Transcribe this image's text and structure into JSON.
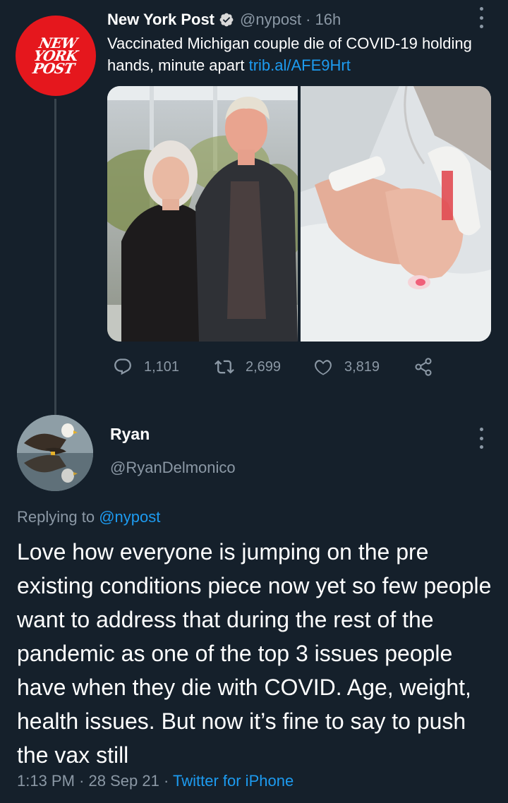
{
  "parent_tweet": {
    "avatar_logo": [
      "NEW",
      "YORK",
      "POST"
    ],
    "display_name": "New York Post",
    "handle": "@nypost",
    "separator": "·",
    "time": "16h",
    "text": "Vaccinated Michigan couple die of COVID-19 holding hands, minute apart",
    "link": "trib.al/AFE9Hrt",
    "stats": {
      "replies": "1,101",
      "retweets": "2,699",
      "likes": "3,819"
    },
    "icons": [
      "verified-badge-icon",
      "more-options-icon",
      "reply-icon",
      "retweet-icon",
      "like-icon",
      "share-icon"
    ]
  },
  "reply_tweet": {
    "display_name": "Ryan",
    "handle": "@RyanDelmonico",
    "replying_prefix": "Replying to",
    "replying_to": "@nypost",
    "text": "Love how everyone is jumping on the pre existing conditions piece now yet so few people want to address that during the rest of the pandemic as one of the top 3 issues people have when they die with COVID. Age, weight, health issues. But now it’s fine to say to push the vax still",
    "time": "1:13 PM",
    "separator": "·",
    "date": "28 Sep 21",
    "source": "Twitter for iPhone"
  },
  "colors": {
    "background": "#15202b",
    "secondary_text": "#8b98a5",
    "link": "#1d9bf0",
    "verified": "#1d9bf0",
    "brand_red": "#e5171d"
  }
}
